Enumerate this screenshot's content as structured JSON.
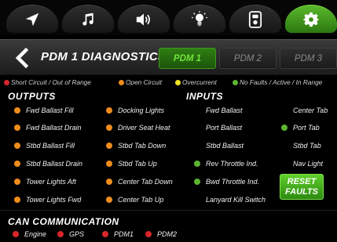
{
  "nav": {
    "tabs": [
      {
        "icon": "navigation-arrow-icon"
      },
      {
        "icon": "music-note-icon"
      },
      {
        "icon": "speaker-icon"
      },
      {
        "icon": "light-bulb-icon"
      },
      {
        "icon": "remote-fob-icon"
      },
      {
        "icon": "gear-icon",
        "active": true
      }
    ]
  },
  "header": {
    "title": "PDM 1 DIAGNOSTICS",
    "tabs": [
      "PDM 1",
      "PDM 2",
      "PDM 3"
    ],
    "active_tab": "PDM 1"
  },
  "legend": {
    "short_circuit": "Short Circuit / Out of Range",
    "open_circuit": "Open Circuit",
    "overcurrent": "Overcurrent",
    "no_faults": "No Faults / Active / In Range"
  },
  "colors": {
    "red": "#d8262b",
    "orange": "#ef8c1c",
    "yellow": "#f1e421",
    "green": "#5cb530",
    "accent_green": "#6fe43a"
  },
  "outputs": {
    "heading": "OUTPUTS",
    "col1": [
      "Fwd Ballast Fill",
      "Fwd Ballast Drain",
      "Stbd Ballast Fill",
      "Stbd Ballast Drain",
      "Tower Lights Aft",
      "Tower Lights Fwd"
    ],
    "col2": [
      "Docking Lights",
      "Driver Seat Heat",
      "Stbd Tab Down",
      "Stbd Tab Up",
      "Center Tab Down",
      "Center Tab Up"
    ]
  },
  "inputs": {
    "heading": "INPUTS",
    "col1": [
      "Fwd Ballast",
      "Port Ballast",
      "Stbd Ballast",
      "Rev Throttle Ind.",
      "Bwd Throttle Ind.",
      "Lanyard Kill Switch"
    ],
    "col2": [
      "Center Tab",
      "Port Tab",
      "Stbd Tab",
      "Nav Light"
    ]
  },
  "reset_button": {
    "line1": "RESET",
    "line2": "FAULTS"
  },
  "can": {
    "heading": "CAN COMMUNICATION",
    "items": [
      "Engine",
      "GPS",
      "PDM1",
      "PDM2"
    ]
  }
}
